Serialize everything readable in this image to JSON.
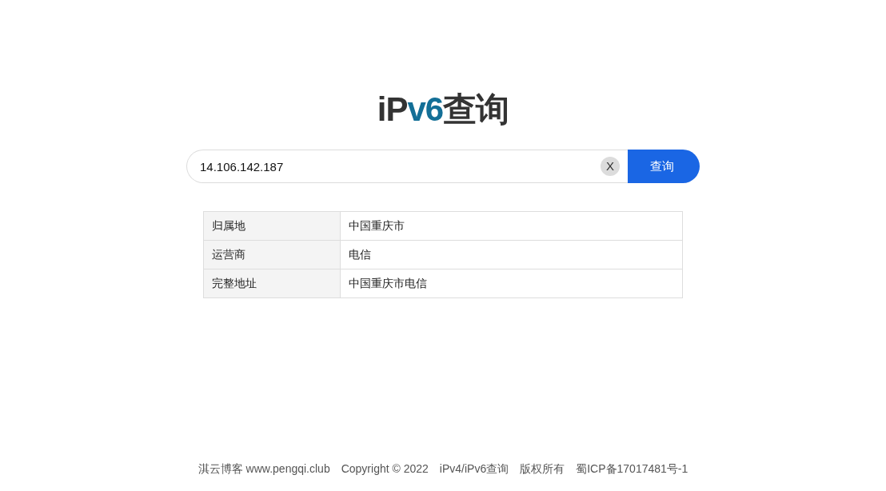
{
  "logo": {
    "parts": [
      {
        "text": "iP",
        "kind": "plain"
      },
      {
        "text": "v6",
        "kind": "accent"
      },
      {
        "text": "查询",
        "kind": "plain"
      }
    ]
  },
  "search": {
    "value": "14.106.142.187",
    "clear_button": "X",
    "button": "查询"
  },
  "table": {
    "rows": [
      {
        "label": "归属地",
        "value": "中国重庆市"
      },
      {
        "label": "运营商",
        "value": "电信"
      },
      {
        "label": "完整地址",
        "value": "中国重庆市电信"
      }
    ]
  },
  "footer": {
    "items": [
      "淇云博客 www.pengqi.club",
      "Copyright © 2022",
      "iPv4/iPv6查询",
      "版权所有",
      "蜀ICP备17017481号-1"
    ]
  }
}
